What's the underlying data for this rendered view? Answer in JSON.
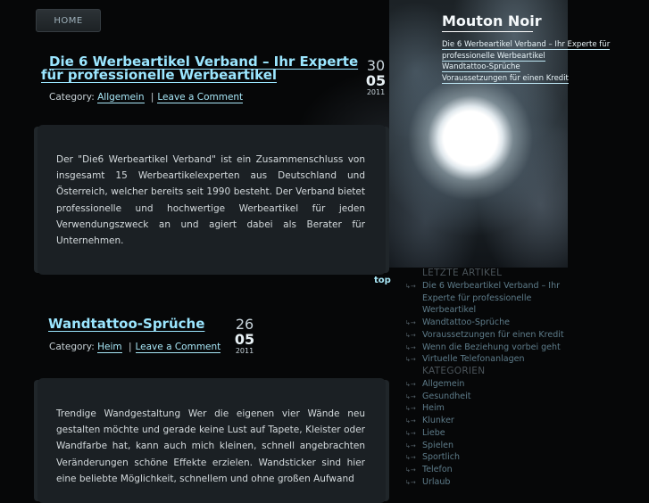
{
  "nav": {
    "home": "HOME"
  },
  "posts": [
    {
      "title_line1": "Die 6 Werbeartikel Verband – Ihr Experte",
      "title_line2": "für professionelle Werbeartikel",
      "date": {
        "day": "30",
        "month": "05",
        "year": "2011"
      },
      "meta": {
        "category_label": "Category:",
        "category": "Allgemein",
        "sep": "|",
        "comments": "Leave a Comment"
      },
      "body": "Der \"Die6 Werbeartikel Verband\" ist ein Zusammenschluss von insgesamt 15 Werbeartikelexperten aus Deutschland und Österreich, welcher bereits seit 1990 besteht. Der Verband bietet professionelle und hochwertige Werbeartikel für jeden Verwendungszweck an und agiert dabei als Berater für Unternehmen."
    },
    {
      "title_line1": "Wandtattoo-Sprüche",
      "date": {
        "day": "26",
        "month": "05",
        "year": "2011"
      },
      "meta": {
        "category_label": "Category:",
        "category": "Heim",
        "sep": "|",
        "comments": "Leave a Comment"
      },
      "body": "Trendige Wandgestaltung Wer die eigenen vier Wände neu gestalten möchte und gerade keine Lust auf Tapete, Kleister oder Wandfarbe hat, kann auch mich kleinen, schnell angebrachten Veränderungen schöne Effekte erzielen. Wandsticker sind hier eine beliebte Möglichkeit, schnellem und ohne großen Aufwand"
    }
  ],
  "top_link": "top",
  "sidebar": {
    "blog_title": "Mouton Noir",
    "recent_top": [
      "Die 6 Werbeartikel Verband – Ihr Experte für",
      "professionelle Werbeartikel",
      "Wandtattoo-Sprüche",
      "Voraussetzungen für einen Kredit"
    ],
    "recent_heading": "LETZTE ARTIKEL",
    "recent_items": [
      "Die 6 Werbeartikel Verband – Ihr",
      "Wandtattoo-Sprüche",
      "Voraussetzungen für einen Kredit",
      "Wenn die Beziehung vorbei geht",
      "Virtuelle Telefonanlagen"
    ],
    "recent_item1_cont": [
      "Experte für professionelle",
      "Werbeartikel"
    ],
    "categories_heading": "KATEGORIEN",
    "categories": [
      "Allgemein",
      "Gesundheit",
      "Heim",
      "Klunker",
      "Liebe",
      "Spielen",
      "Sportlich",
      "Telefon",
      "Urlaub"
    ]
  }
}
